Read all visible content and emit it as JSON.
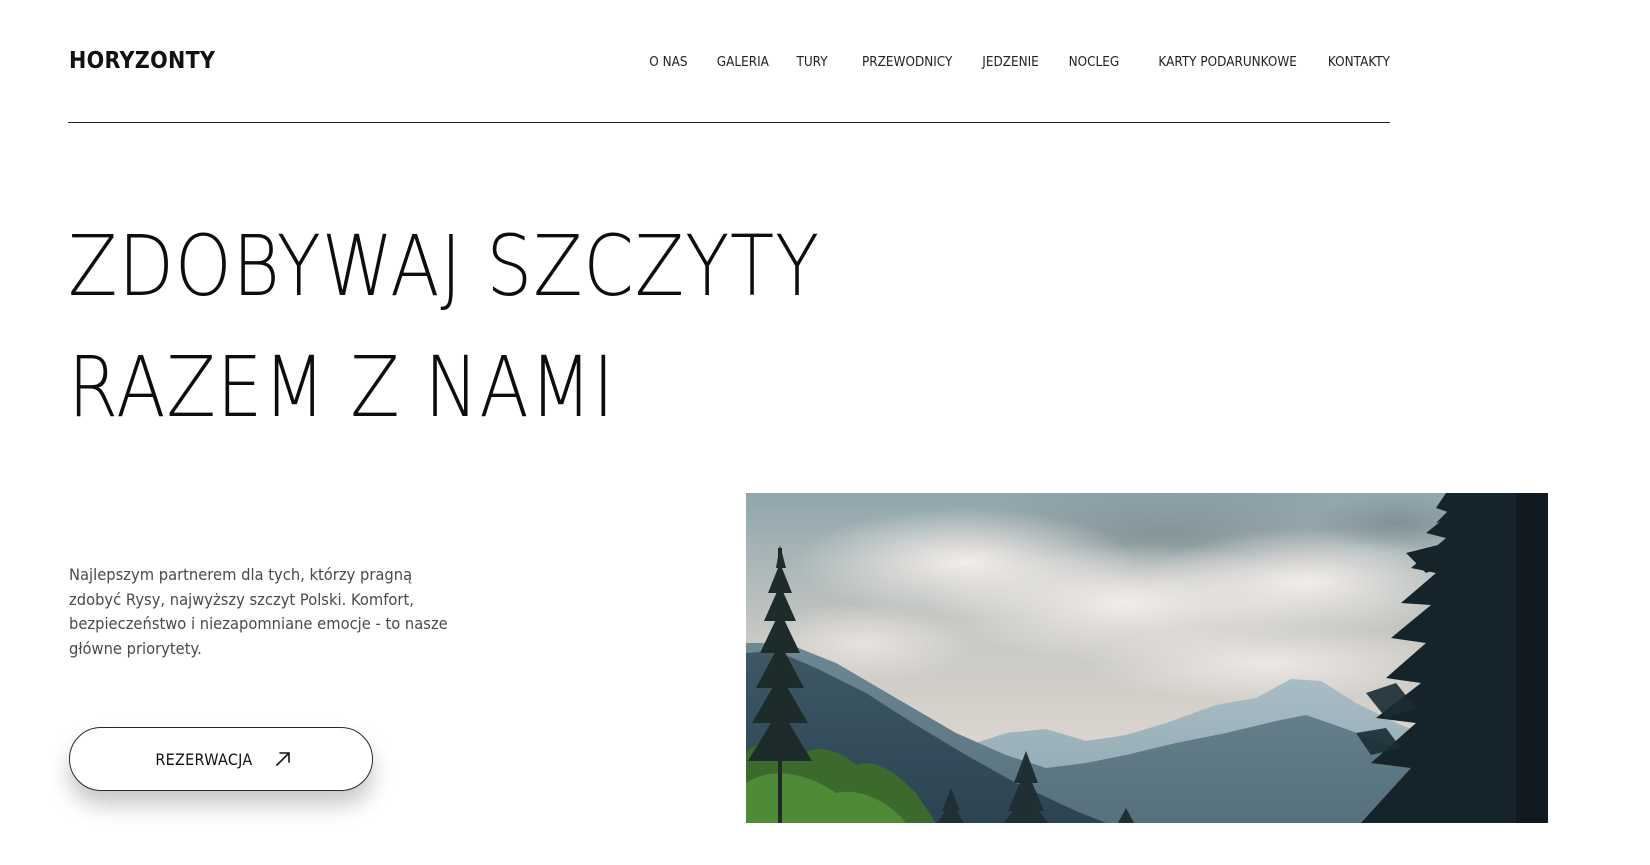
{
  "header": {
    "logo": "HORYZONTY",
    "nav": [
      {
        "label": "O NAS",
        "name": "nav-o-nas"
      },
      {
        "label": "GALERIA",
        "name": "nav-galeria"
      },
      {
        "label": "TURY",
        "name": "nav-tury"
      },
      {
        "label": "PRZEWODNICY",
        "name": "nav-przewodnicy"
      },
      {
        "label": "JEDZENIE",
        "name": "nav-jedzenie"
      },
      {
        "label": "NOCLEG",
        "name": "nav-nocleg"
      },
      {
        "label": "KARTY PODARUNKOWE",
        "name": "nav-karty-podarunkowe"
      },
      {
        "label": "KONTAKTY",
        "name": "nav-kontakty"
      }
    ]
  },
  "hero": {
    "title_line1": "ZDOBYWAJ SZCZYTY",
    "title_line2": "RAZEM Z NAMI",
    "intro": "Najlepszym partnerem dla tych, którzy pragną zdobyć Rysy, najwyższy szczyt Polski. Komfort, bezpieczeństwo i niezapomniane emocje - to nasze główne priorytety.",
    "cta_label": "REZERWACJA",
    "cta_icon": "arrow-up-right-icon",
    "image_icon": "mountain-landscape-photo"
  },
  "colors": {
    "text": "#111111",
    "muted": "#4a4a4a",
    "background": "#ffffff",
    "rule": "#222222"
  }
}
